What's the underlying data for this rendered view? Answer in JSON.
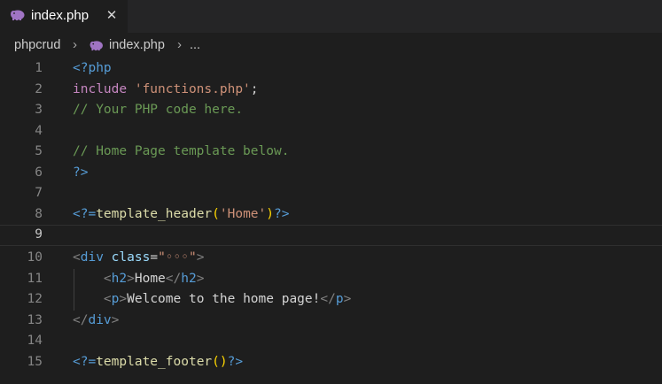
{
  "tab": {
    "filename": "index.php",
    "close_glyph": "✕",
    "icon": "php-elephant-icon",
    "icon_color": "#a074c4"
  },
  "breadcrumb": {
    "folder": "phpcrud",
    "sep1": "›",
    "file": "index.php",
    "sep2": "›",
    "more": "..."
  },
  "editor": {
    "current_line": 9,
    "lines": [
      {
        "n": "1"
      },
      {
        "n": "2"
      },
      {
        "n": "3"
      },
      {
        "n": "4"
      },
      {
        "n": "5"
      },
      {
        "n": "6"
      },
      {
        "n": "7"
      },
      {
        "n": "8"
      },
      {
        "n": "9"
      },
      {
        "n": "10"
      },
      {
        "n": "11"
      },
      {
        "n": "12"
      },
      {
        "n": "13"
      },
      {
        "n": "14"
      },
      {
        "n": "15"
      }
    ],
    "tokens": {
      "l1_open": "<?php",
      "l2_include": "include",
      "l2_space": " ",
      "l2_str": "'functions.php'",
      "l2_semi": ";",
      "l3_comment": "// Your PHP code here.",
      "l5_comment": "// Home Page template below.",
      "l6_close": "?>",
      "l8_open": "<?=",
      "l8_fn": "template_header",
      "l8_lp": "(",
      "l8_str": "'Home'",
      "l8_rp": ")",
      "l8_close": "?>",
      "l10_lt": "<",
      "l10_tag": "div",
      "l10_space": " ",
      "l10_attr": "class",
      "l10_eq": "=",
      "l10_val": "\"◦◦◦\"",
      "l10_gt": ">",
      "l11_indent": "    ",
      "l11_lt": "<",
      "l11_tag": "h2",
      "l11_gt": ">",
      "l11_text": "Home",
      "l11_clt": "</",
      "l11_ctag": "h2",
      "l11_cgt": ">",
      "l12_indent": "    ",
      "l12_lt": "<",
      "l12_tag": "p",
      "l12_gt": ">",
      "l12_text": "Welcome to the home page!",
      "l12_clt": "</",
      "l12_ctag": "p",
      "l12_cgt": ">",
      "l13_clt": "</",
      "l13_ctag": "div",
      "l13_cgt": ">",
      "l15_open": "<?=",
      "l15_fn": "template_footer",
      "l15_parens": "()",
      "l15_close": "?>"
    }
  },
  "colors": {
    "background": "#1e1e1e",
    "tabbar": "#252526",
    "keyword": "#c586c0",
    "string": "#ce9178",
    "comment": "#6a9955",
    "tag": "#569cd6",
    "function": "#dcdcaa",
    "attribute": "#9cdcfe",
    "bracket": "#ffd700"
  }
}
